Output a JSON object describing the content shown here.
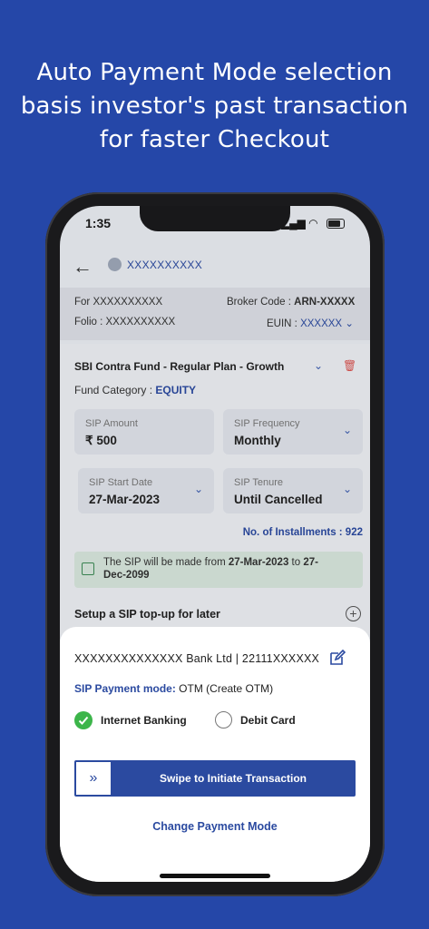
{
  "headline": {
    "line1": "Auto Payment Mode selection",
    "line2": "basis investor's past transaction",
    "line3": "for faster Checkout"
  },
  "status_bar": {
    "time": "1:35"
  },
  "app_bar": {
    "investor_name": "XXXXXXXXXX"
  },
  "info": {
    "for_label": "For XXXXXXXXXX",
    "folio_label": "Folio : XXXXXXXXXX",
    "broker_label": "Broker Code :",
    "broker_value": "ARN-XXXXX",
    "euin_label": "EUIN :",
    "euin_value": "XXXXXX"
  },
  "fund": {
    "name": "SBI Contra Fund - Regular Plan - Growth",
    "category_label": "Fund Category :",
    "category_value": "EQUITY",
    "sip_amount_label": "SIP Amount",
    "sip_amount_value": "₹ 500",
    "sip_frequency_label": "SIP Frequency",
    "sip_frequency_value": "Monthly",
    "sip_start_label": "SIP Start Date",
    "sip_start_value": "27-Mar-2023",
    "sip_tenure_label": "SIP Tenure",
    "sip_tenure_value": "Until Cancelled",
    "installments": "No. of Installments : 922"
  },
  "notice": {
    "prefix": "The SIP will be made from",
    "start": "27-Mar-2023",
    "middle": "to",
    "end_part1": "27-",
    "end_part2": "Dec-2099"
  },
  "topup": {
    "label": "Setup a SIP top-up for later"
  },
  "sheet": {
    "bank_text": "XXXXXXXXXXXXXX  Bank Ltd | 22111XXXXXX",
    "mode_label": "SIP Payment mode:",
    "mode_value": "OTM (Create OTM)",
    "option_internet": "Internet Banking",
    "option_debit": "Debit Card",
    "swipe_label": "Swipe to Initiate Transaction",
    "change_label": "Change Payment Mode"
  },
  "colors": {
    "background": "#2547a8",
    "accent": "#2b4aa0",
    "selected_radio": "#3cb54a"
  }
}
